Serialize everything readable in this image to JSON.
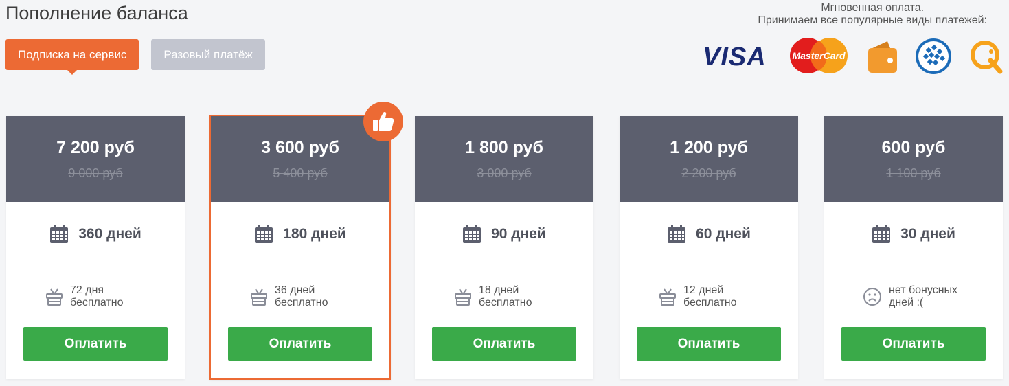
{
  "page": {
    "title": "Пополнение баланса"
  },
  "tabs": [
    {
      "label": "Подписка на сервис",
      "active": true
    },
    {
      "label": "Разовый платёж",
      "active": false
    }
  ],
  "payment_info": {
    "line1": "Мгновенная оплата.",
    "line2": "Принимаем все популярные виды платежей:",
    "logos": [
      {
        "name": "visa",
        "text": "VISA"
      },
      {
        "name": "mastercard",
        "text": "MasterCard"
      },
      {
        "name": "wallet-icon"
      },
      {
        "name": "webmoney-icon"
      },
      {
        "name": "qiwi-icon"
      }
    ]
  },
  "plans": [
    {
      "price": "7 200 руб",
      "old_price": "9 000 руб",
      "days": "360 дней",
      "bonus": "72 дня бесплатно",
      "button": "Оплатить",
      "featured": false
    },
    {
      "price": "3 600 руб",
      "old_price": "5 400 руб",
      "days": "180 дней",
      "bonus": "36 дней бесплатно",
      "button": "Оплатить",
      "featured": true
    },
    {
      "price": "1 800 руб",
      "old_price": "3 000 руб",
      "days": "90 дней",
      "bonus": "18 дней бесплатно",
      "button": "Оплатить",
      "featured": false
    },
    {
      "price": "1 200 руб",
      "old_price": "2 200 руб",
      "days": "60 дней",
      "bonus": "12 дней бесплатно",
      "button": "Оплатить",
      "featured": false
    },
    {
      "price": "600 руб",
      "old_price": "1 100 руб",
      "days": "30 дней",
      "bonus": "нет бонусных дней :(",
      "button": "Оплатить",
      "featured": false
    }
  ],
  "colors": {
    "accent": "#ec6a34",
    "header": "#5c5f6e",
    "pay": "#3aaa49",
    "tab_inactive": "#c2c5cf"
  }
}
